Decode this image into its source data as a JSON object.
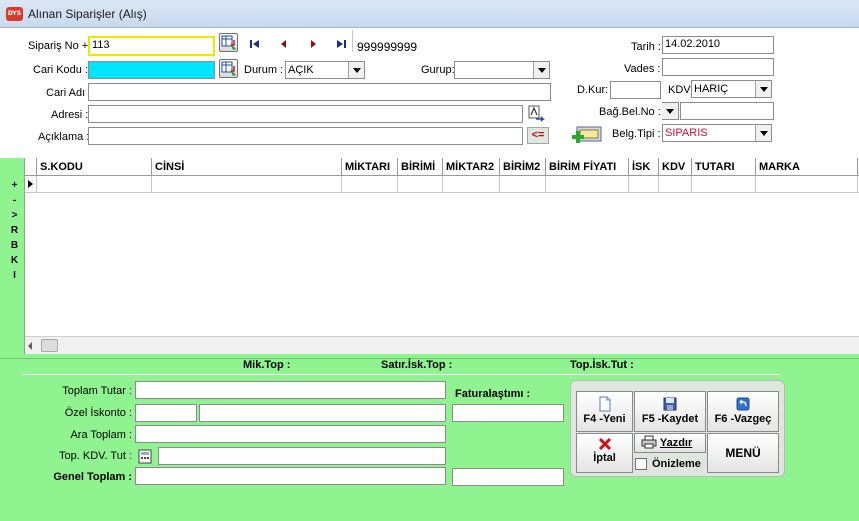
{
  "window": {
    "title": "Alınan Siparişler (Alış)",
    "icon_text": "DYS"
  },
  "header": {
    "siparis_no_label": "Sipariş No +:",
    "siparis_no_value": "113",
    "record_count": "999999999",
    "cari_kodu_label": "Cari Kodu :",
    "cari_kodu_value": "",
    "durum_label": "Durum :",
    "durum_value": "AÇIK",
    "gurup_label": "Gurup:",
    "gurup_value": "",
    "cari_adi_label": "Cari Adı :",
    "adresi_label": "Adresi :",
    "aciklama_label": "Açıklama :",
    "aciklama_btn": "<=",
    "tarih_label": "Tarih :",
    "tarih_value": "14.02.2010",
    "vades_label": "Vades :",
    "dkur_label": "D.Kur:",
    "kdv_label": "KDV",
    "kdv_value": "HARIÇ",
    "bagbelno_label": "Bağ.Bel.No :",
    "belgtipi_label": "Belg.Tipi :",
    "belgtipi_value": "SIPARIS"
  },
  "sidebar_letters": [
    "+",
    "-",
    ">",
    "R",
    "B",
    "K",
    "I"
  ],
  "grid": {
    "columns": [
      "S.KODU",
      "CİNSİ",
      "MİKTARI",
      "BİRİMİ",
      "MİKTAR2",
      "BİRİM2",
      "BİRİM FİYATI",
      "İSK",
      "KDV",
      "TUTARI",
      "MARKA"
    ]
  },
  "summary": {
    "mik_top": "Mik.Top :",
    "satir_isk_top": "Satır.İsk.Top :",
    "top_isk_tut": "Top.İsk.Tut :"
  },
  "totals": {
    "toplam_tutar": "Toplam Tutar :",
    "ozel_iskonto": "Özel İskonto :",
    "ara_toplam": "Ara Toplam :",
    "top_kdv_tut": "Top. KDV. Tut :",
    "genel_toplam": "Genel Toplam :",
    "faturalastimi": "Faturalaştımı :"
  },
  "actions": {
    "yeni": "F4 -Yeni",
    "kaydet": "F5 -Kaydet",
    "vazgec": "F6 -Vazgeç",
    "iptal": "İptal",
    "yazdir": "Yazdır",
    "menu": "MENÜ",
    "onizleme": "Önizleme"
  },
  "colors": {
    "panel_green": "#8ff48f",
    "cari_kodu_bg": "#00e5ff",
    "siparis_border": "#f2e600",
    "belg_tipi_text": "#c8102e",
    "iptal_red": "#d01010"
  }
}
